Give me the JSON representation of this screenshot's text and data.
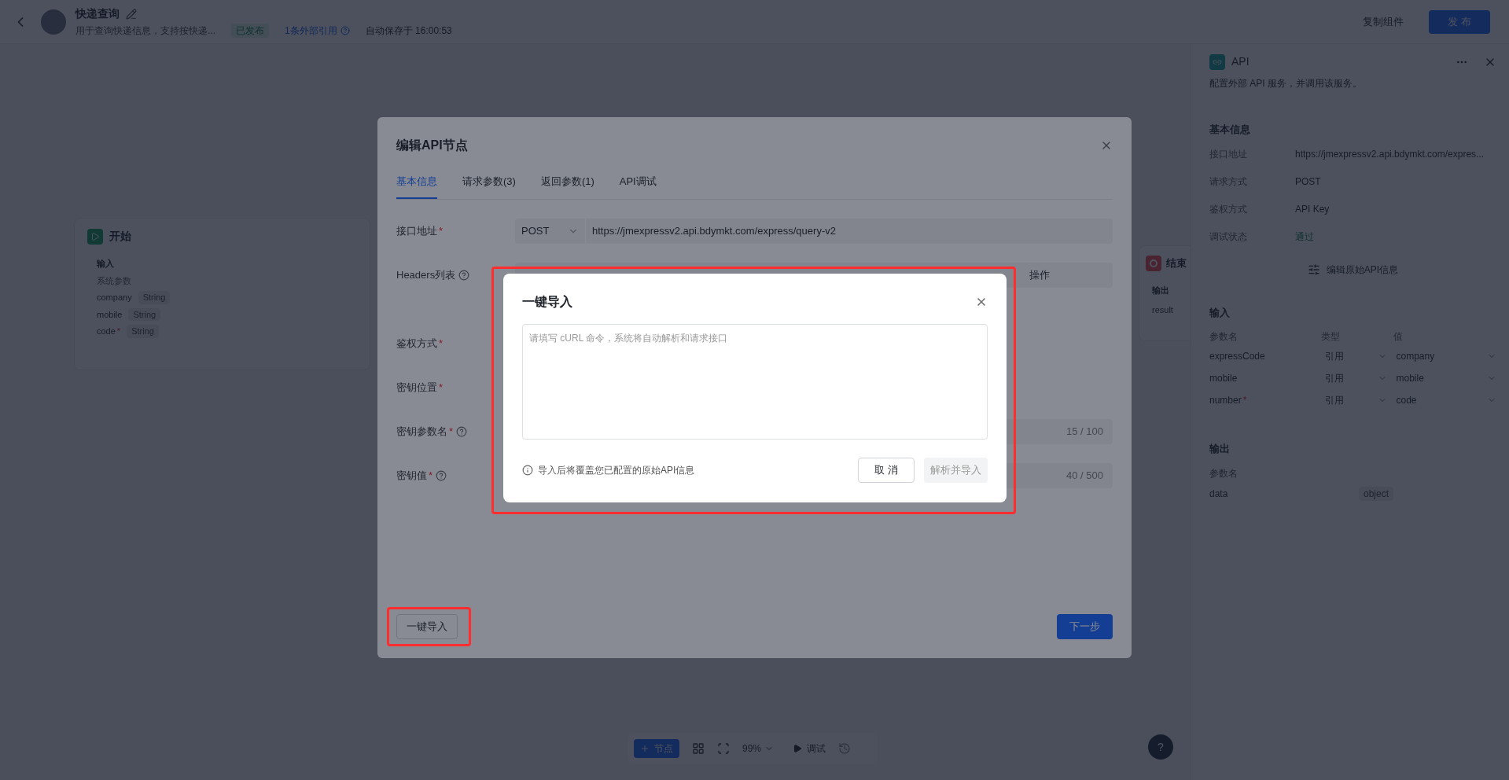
{
  "header": {
    "title": "快递查询",
    "description": "用于查询快递信息，支持按快递...",
    "status": "已发布",
    "references": "1条外部引用",
    "autosave": "自动保存于 16:00:53",
    "copy_button": "复制组件",
    "publish_button": "发 布"
  },
  "start_node": {
    "title": "开始",
    "section": "输入",
    "group": "系统参数",
    "params": [
      {
        "name": "company",
        "type": "String"
      },
      {
        "name": "mobile",
        "type": "String"
      },
      {
        "name": "code",
        "required_mark": "*",
        "type": "String"
      }
    ]
  },
  "end_node": {
    "title": "结束",
    "section": "输出",
    "params": [
      "result"
    ]
  },
  "toolbar": {
    "node_button": "节点",
    "zoom": "99%",
    "debug": "调试"
  },
  "help": "?",
  "side_panel": {
    "title": "API",
    "description": "配置外部 API 服务，并调用该服务。",
    "basic_title": "基本信息",
    "basic": [
      {
        "label": "接口地址",
        "value": "https://jmexpressv2.api.bdymkt.com/expres...",
        "kind": "text"
      },
      {
        "label": "请求方式",
        "value": "POST",
        "kind": "text"
      },
      {
        "label": "鉴权方式",
        "value": "API Key",
        "kind": "text"
      },
      {
        "label": "调试状态",
        "value": "通过",
        "kind": "success"
      }
    ],
    "edit_button": "编辑原始API信息",
    "input_title": "输入",
    "input_columns": [
      "参数名",
      "类型",
      "值"
    ],
    "inputs": [
      {
        "name": "expressCode",
        "type": "引用",
        "value": "company"
      },
      {
        "name": "mobile",
        "type": "引用",
        "value": "mobile"
      },
      {
        "name": "number",
        "required_mark": "*",
        "type": "引用",
        "value": "code"
      }
    ],
    "output_title": "输出",
    "output_columns": [
      "参数名"
    ],
    "outputs": [
      {
        "name": "data",
        "type": "object"
      }
    ]
  },
  "edit_modal": {
    "title": "编辑API节点",
    "tabs": [
      {
        "label": "基本信息",
        "selected": true
      },
      {
        "label": "请求参数(3)",
        "selected": false
      },
      {
        "label": "返回参数(1)",
        "selected": false
      },
      {
        "label": "API调试",
        "selected": false
      }
    ],
    "fields": [
      {
        "kind": "url",
        "label": "接口地址",
        "required_mark": "*",
        "help": false,
        "method": "POST",
        "value": "https://jmexpressv2.api.bdymkt.com/express/query-v2"
      },
      {
        "kind": "table",
        "label": "Headers列表",
        "help": true,
        "columns": [
          "操作"
        ]
      },
      {
        "kind": "blank",
        "label": "鉴权方式",
        "required_mark": "*",
        "help": false
      },
      {
        "kind": "blank",
        "label": "密钥位置",
        "required_mark": "*",
        "help": false
      },
      {
        "kind": "counter",
        "label": "密钥参数名",
        "required_mark": "*",
        "help": true,
        "count": "15 / 100"
      },
      {
        "kind": "counter",
        "label": "密钥值",
        "required_mark": "*",
        "help": true,
        "count": "40 / 500"
      }
    ],
    "import_button": "一键导入",
    "next_button": "下一步"
  },
  "import_dialog": {
    "title": "一键导入",
    "placeholder": "请填写 cURL 命令，系统将自动解析和请求接口",
    "note": "导入后将覆盖您已配置的原始API信息",
    "cancel_button": "取 消",
    "confirm_button": {
      "label": "解析并导入",
      "disabled": true
    }
  }
}
